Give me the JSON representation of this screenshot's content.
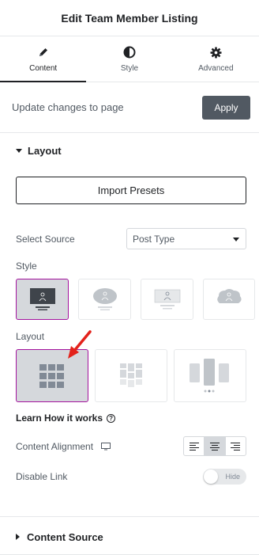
{
  "header": {
    "title": "Edit Team Member Listing"
  },
  "tabs": [
    {
      "label": "Content",
      "icon": "pencil-icon",
      "active": true
    },
    {
      "label": "Style",
      "icon": "half-circle-icon",
      "active": false
    },
    {
      "label": "Advanced",
      "icon": "gear-icon",
      "active": false
    }
  ],
  "update": {
    "text": "Update changes to page",
    "apply_label": "Apply"
  },
  "layout_section": {
    "title": "Layout",
    "import_label": "Import Presets",
    "select_source_label": "Select Source",
    "select_source_value": "Post Type",
    "style_label": "Style",
    "style_options": [
      "monitor-avatar-style",
      "circle-avatar-style",
      "card-avatar-style",
      "cloud-avatar-style"
    ],
    "style_selected": 0,
    "layout_label": "Layout",
    "layout_options": [
      "grid-layout",
      "masonry-layout",
      "carousel-layout"
    ],
    "layout_selected": 0,
    "learn_label": "Learn How it works",
    "content_alignment_label": "Content Alignment",
    "alignment_options": [
      "left",
      "center",
      "right"
    ],
    "alignment_selected": "center",
    "disable_link_label": "Disable Link",
    "disable_link_toggle": "Hide"
  },
  "content_source_section": {
    "title": "Content Source"
  },
  "colors": {
    "accent": "#a4139e",
    "arrow": "#e3221b",
    "button": "#515962"
  }
}
